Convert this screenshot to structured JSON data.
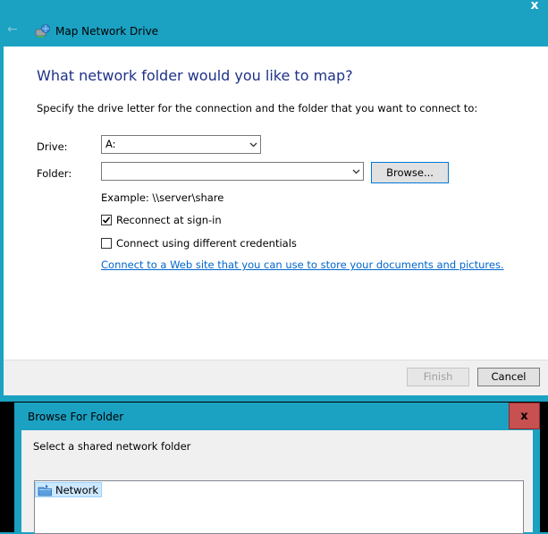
{
  "map_network_drive": {
    "window_title": "Map Network Drive",
    "close_glyph": "x",
    "back_glyph": "←",
    "heading": "What network folder would you like to map?",
    "instruction": "Specify the drive letter for the connection and the folder that you want to connect to:",
    "drive_label": "Drive:",
    "drive_value": "A:",
    "folder_label": "Folder:",
    "folder_value": "",
    "browse_button": "Browse...",
    "example": "Example: \\\\server\\share",
    "reconnect": {
      "label": "Reconnect at sign-in",
      "checked": true
    },
    "different_credentials": {
      "label": "Connect using different credentials",
      "checked": false
    },
    "web_link": "Connect to a Web site that you can use to store your documents and pictures",
    "web_link_suffix": ".",
    "finish_button": "Finish",
    "cancel_button": "Cancel",
    "icons": {
      "back": "back-arrow-icon",
      "app": "network-drive-icon",
      "close": "close-icon",
      "chevron": "chevron-down-icon"
    }
  },
  "browse_for_folder": {
    "title": "Browse For Folder",
    "close_glyph": "x",
    "instruction": "Select a shared network folder",
    "tree_items": [
      {
        "label": "Network",
        "icon": "network-icon",
        "selected": true
      }
    ]
  },
  "colors": {
    "window_frame": "#1ba1c2",
    "heading": "#1e3287",
    "link": "#0066cc",
    "close_button": "#c75050",
    "selection": "#cce8ff"
  }
}
